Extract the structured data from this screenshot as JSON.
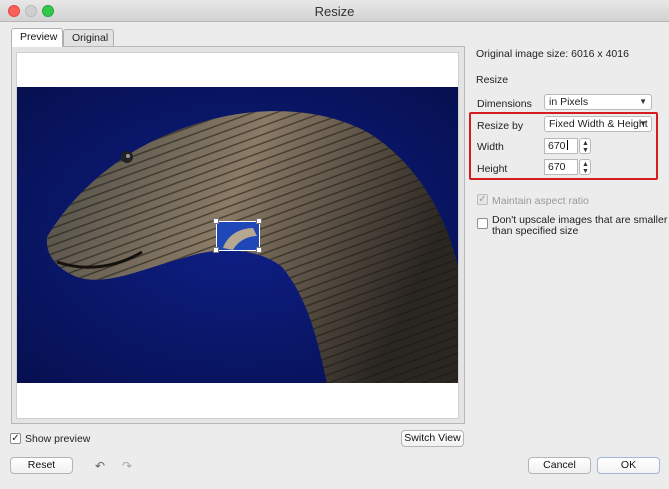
{
  "window": {
    "title": "Resize"
  },
  "tabs": [
    {
      "label": "Preview",
      "active": true
    },
    {
      "label": "Original",
      "active": false
    }
  ],
  "info": {
    "original_size": "Original image size: 6016 x 4016"
  },
  "resize": {
    "section_label": "Resize",
    "dimensions": {
      "label": "Dimensions",
      "value": "in Pixels"
    },
    "resize_by": {
      "label": "Resize by",
      "value": "Fixed Width & Height"
    },
    "width": {
      "label": "Width",
      "value": "670"
    },
    "height": {
      "label": "Height",
      "value": "670"
    }
  },
  "options": {
    "maintain_aspect": {
      "label": "Maintain aspect ratio",
      "checked": true,
      "disabled": true
    },
    "no_upscale": {
      "label_line1": "Don't upscale images that are smaller",
      "label_line2": "than specified size",
      "checked": false
    }
  },
  "preview": {
    "show_preview_label": "Show preview",
    "show_preview_checked": true,
    "switch_view_label": "Switch View"
  },
  "footer": {
    "reset_label": "Reset",
    "cancel_label": "Cancel",
    "ok_label": "OK"
  },
  "icons": {
    "undo": "undo-icon",
    "redo": "redo-icon",
    "check": "✓"
  },
  "colors": {
    "highlight": "#d51d1d",
    "photo_background": "#0b1a6e"
  }
}
